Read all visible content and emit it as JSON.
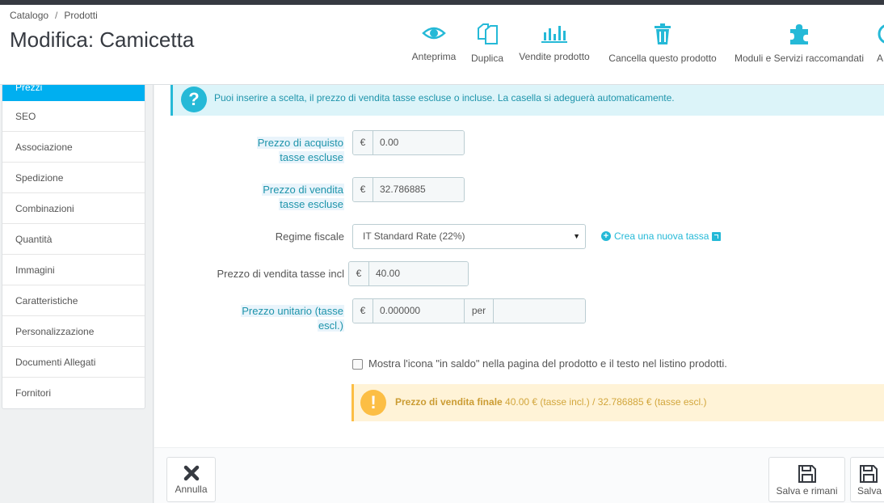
{
  "breadcrumb": {
    "item1": "Catalogo",
    "separator": "/",
    "item2": "Prodotti"
  },
  "page_title": "Modifica: Camicetta",
  "toolbar": {
    "preview": {
      "label": "Anteprima",
      "icon": "eye-icon"
    },
    "duplicate": {
      "label": "Duplica",
      "icon": "copy-icon"
    },
    "sales": {
      "label": "Vendite prodotto",
      "icon": "bar-chart-icon"
    },
    "delete": {
      "label": "Cancella questo prodotto",
      "icon": "trash-icon"
    },
    "modules": {
      "label": "Moduli e Servizi raccomandati",
      "icon": "puzzle-icon"
    },
    "more": {
      "label": "A",
      "icon": "help-icon"
    }
  },
  "sidebar": {
    "active": "Prezzi",
    "items": [
      "SEO",
      "Associazione",
      "Spedizione",
      "Combinazioni",
      "Quantità",
      "Immagini",
      "Caratteristiche",
      "Personalizzazione",
      "Documenti Allegati",
      "Fornitori"
    ]
  },
  "info_alert": "Puoi inserire a scelta, il prezzo di vendita tasse escluse o incluse. La casella si adeguerà automaticamente.",
  "form": {
    "wholesale": {
      "label_line1": "Prezzo di acquisto",
      "label_line2": "tasse escluse",
      "currency": "€",
      "value": "0.00"
    },
    "price_excl": {
      "label_line1": "Prezzo di vendita",
      "label_line2": "tasse escluse",
      "currency": "€",
      "value": "32.786885"
    },
    "tax_rule": {
      "label": "Regime fiscale",
      "value": "IT Standard Rate (22%)",
      "create_link": "Crea una nuova tassa"
    },
    "price_incl": {
      "label": "Prezzo di vendita tasse incl",
      "currency": "€",
      "value": "40.00"
    },
    "unit_price": {
      "label_line1": "Prezzo unitario (tasse",
      "label_line2": "escl.)",
      "currency": "€",
      "value": "0.000000",
      "per": "per",
      "unity": ""
    },
    "on_sale": {
      "label": "Mostra l'icona \"in saldo\" nella pagina del prodotto e il testo nel listino prodotti.",
      "checked": false
    }
  },
  "final_price": {
    "title": "Prezzo di vendita finale",
    "value": "40.00 € (tasse incl.) / 32.786885 € (tasse escl.)"
  },
  "footer": {
    "cancel": "Annulla",
    "save_stay": "Salva e rimani",
    "save": "Salva"
  },
  "colors": {
    "accent": "#00aff0",
    "info": "#25b9d7",
    "warning": "#fcbe44"
  }
}
